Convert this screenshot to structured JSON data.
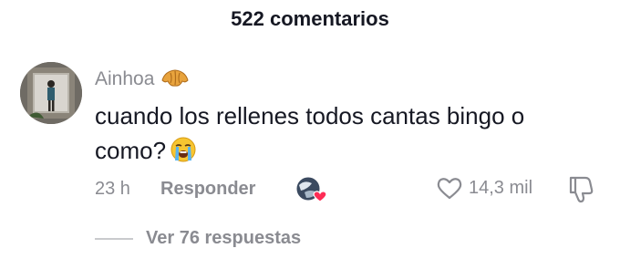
{
  "header": {
    "title": "522 comentarios"
  },
  "comment": {
    "username": "Ainhoa",
    "username_badge_icon": "croissant-icon",
    "text": "cuando los rellenes todos cantas bingo o como?",
    "text_emoji_icon": "loudly-crying-face-icon",
    "time": "23 h",
    "reply_label": "Responder",
    "liked_by_creator_icon": "creator-liked-heart-icon",
    "like_icon": "heart-outline-icon",
    "like_count": "14,3 mil",
    "dislike_icon": "thumbs-down-icon",
    "view_replies_label": "Ver 76 respuestas"
  },
  "colors": {
    "text_primary": "#161823",
    "text_secondary": "#8a8b91",
    "heart_badge": "#fe2c55",
    "background": "#ffffff"
  }
}
